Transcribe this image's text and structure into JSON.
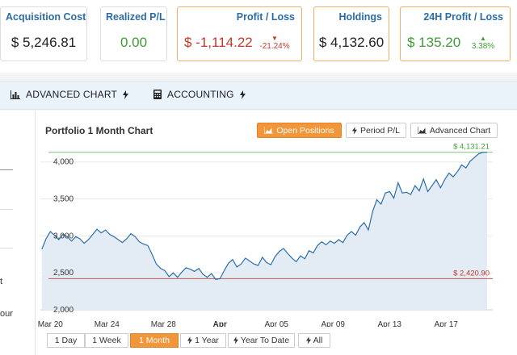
{
  "cards": {
    "acquisition": {
      "label": "Acquisition Cost",
      "value": "$ 5,246.81"
    },
    "realized": {
      "label": "Realized P/L",
      "value": "0.00"
    },
    "profit_loss": {
      "label": "Profit / Loss",
      "value": "$ -1,114.22",
      "change": "-21.24%"
    },
    "holdings": {
      "label": "Holdings",
      "value": "$ 4,132.60"
    },
    "profit_24h": {
      "label": "24H Profit / Loss",
      "value": "$ 135.20",
      "change": "3.38%"
    }
  },
  "tabs": {
    "advanced_chart": "ADVANCED CHART",
    "accounting": "ACCOUNTING"
  },
  "left_fragments": {
    "a": "t",
    "b": "our"
  },
  "chart_panel": {
    "title": "Portfolio 1 Month Chart",
    "buttons": {
      "open_positions": "Open Positions",
      "period_pl": "Period P/L",
      "advanced_chart": "Advanced Chart"
    },
    "ranges": [
      "1 Day",
      "1 Week",
      "1 Month",
      "1 Year",
      "Year To Date",
      "All"
    ],
    "active_range": "1 Month"
  },
  "colors": {
    "accent": "#f2963a",
    "blue_label": "#2d6ca2",
    "green": "#3f9c35",
    "red": "#c0392b",
    "line": "#2c6fa6",
    "area": "#e3ecf4"
  },
  "chart_data": {
    "type": "area",
    "title": "Portfolio 1 Month Chart",
    "ylim": [
      2000,
      4150
    ],
    "y_ticks": [
      "4,000",
      "3,500",
      "3,000",
      "2,500",
      "2,000"
    ],
    "y_tick_values": [
      4000,
      3500,
      3000,
      2500,
      2000
    ],
    "x_ticks": [
      "Mar 20",
      "Mar 24",
      "Mar 28",
      "Apr",
      "Apr 05",
      "Apr 09",
      "Apr 13",
      "Apr 17"
    ],
    "x_tick_days": [
      0,
      4,
      8,
      12,
      16,
      20,
      24,
      28
    ],
    "x_range_days": [
      -0.7,
      31.3
    ],
    "max_line": {
      "value": 4131.21,
      "label": "$ 4,131.21"
    },
    "min_line": {
      "value": 2420.9,
      "label": "$ 2,420.90"
    },
    "series": [
      {
        "days": [
          -0.6,
          -0.3,
          0,
          0.3,
          0.6,
          0.9,
          1.2,
          1.5,
          1.8,
          2.1,
          2.4,
          2.7,
          3.0,
          3.3,
          3.6,
          3.9,
          4.2,
          4.5,
          4.8,
          5.1,
          5.4,
          5.7,
          6.0,
          6.3,
          6.6,
          6.9,
          7.2,
          7.5,
          7.8,
          8.1,
          8.4,
          8.7,
          9.0,
          9.3,
          9.6,
          9.9,
          10.2,
          10.5,
          10.8,
          11.1,
          11.4,
          11.7,
          12.0,
          12.3,
          12.6,
          12.9,
          13.2,
          13.5,
          13.8,
          14.1,
          14.4,
          14.7,
          15.0,
          15.3,
          15.6,
          15.9,
          16.2,
          16.5,
          16.8,
          17.1,
          17.4,
          17.7,
          18.0,
          18.3,
          18.6,
          18.9,
          19.2,
          19.5,
          19.8,
          20.1,
          20.4,
          20.7,
          21.0,
          21.3,
          21.6,
          21.9,
          22.2,
          22.5,
          22.8,
          23.1,
          23.4,
          23.7,
          24.0,
          24.3,
          24.6,
          24.9,
          25.2,
          25.5,
          25.8,
          26.1,
          26.4,
          26.7,
          27.0,
          27.3,
          27.6,
          27.9,
          28.2,
          28.5,
          28.8,
          29.1,
          29.4,
          29.7,
          30.0,
          30.3,
          30.6,
          30.9
        ],
        "values": [
          2820,
          2960,
          3060,
          3010,
          2950,
          3020,
          2990,
          2930,
          2990,
          2960,
          2900,
          2950,
          3020,
          3090,
          3040,
          3080,
          3020,
          2990,
          2950,
          2910,
          2960,
          3030,
          2990,
          2920,
          2890,
          2870,
          2750,
          2620,
          2560,
          2530,
          2450,
          2500,
          2440,
          2510,
          2570,
          2550,
          2520,
          2560,
          2480,
          2440,
          2490,
          2410,
          2420,
          2530,
          2630,
          2680,
          2580,
          2620,
          2700,
          2660,
          2620,
          2600,
          2710,
          2640,
          2610,
          2720,
          2790,
          2830,
          2760,
          2700,
          2650,
          2730,
          2690,
          2800,
          2770,
          2870,
          2920,
          2880,
          2930,
          2900,
          2950,
          2910,
          3010,
          3060,
          3010,
          3120,
          3180,
          3080,
          3330,
          3490,
          3430,
          3580,
          3600,
          3510,
          3720,
          3580,
          3590,
          3560,
          3680,
          3610,
          3770,
          3600,
          3680,
          3760,
          3650,
          3760,
          3850,
          3800,
          3870,
          3960,
          3920,
          4010,
          4060,
          4110,
          4130,
          4130
        ]
      }
    ]
  }
}
